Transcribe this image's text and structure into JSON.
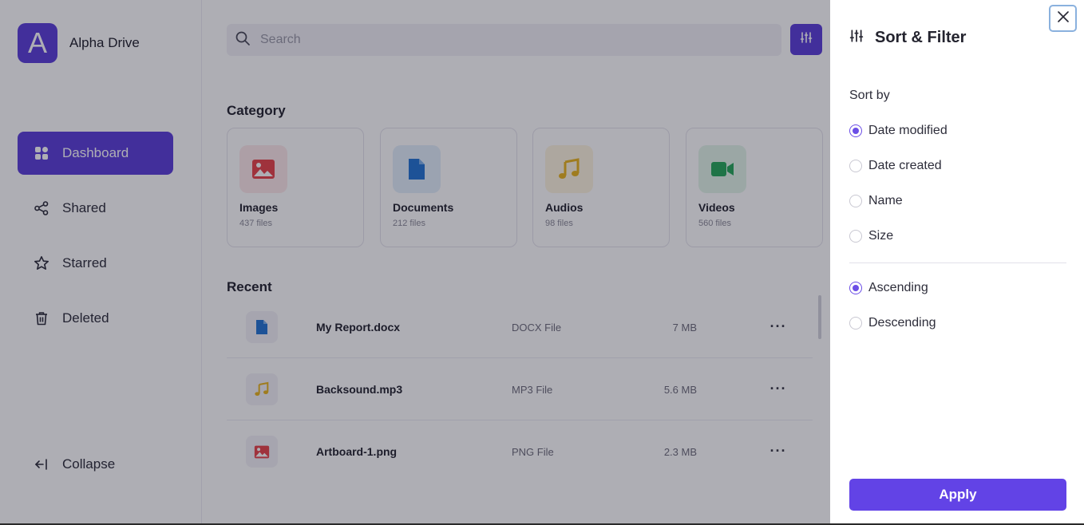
{
  "brand": {
    "logo_letter": "A",
    "name": "Alpha Drive"
  },
  "sidebar": {
    "items": [
      {
        "label": "Dashboard",
        "icon": "dashboard-grid-icon",
        "active": true
      },
      {
        "label": "Shared",
        "icon": "share-icon",
        "active": false
      },
      {
        "label": "Starred",
        "icon": "star-icon",
        "active": false
      },
      {
        "label": "Deleted",
        "icon": "trash-icon",
        "active": false
      }
    ],
    "collapse_label": "Collapse"
  },
  "search": {
    "placeholder": "Search",
    "value": ""
  },
  "category": {
    "title": "Category",
    "items": [
      {
        "name": "Images",
        "count": "437 files",
        "icon": "image-icon",
        "color": "#e8434a",
        "bg": "#fde9ea"
      },
      {
        "name": "Documents",
        "count": "212 files",
        "icon": "document-icon",
        "color": "#2474d4",
        "bg": "#e3eefb"
      },
      {
        "name": "Audios",
        "count": "98 files",
        "icon": "music-note-icon",
        "color": "#e8b41e",
        "bg": "#fdf5e0"
      },
      {
        "name": "Videos",
        "count": "560 files",
        "icon": "video-camera-icon",
        "color": "#27a85a",
        "bg": "#e2f5e9"
      }
    ]
  },
  "recent": {
    "title": "Recent",
    "files": [
      {
        "name": "My Report.docx",
        "type": "DOCX File",
        "size": "7 MB",
        "icon": "document-icon",
        "more": "···"
      },
      {
        "name": "Backsound.mp3",
        "type": "MP3 File",
        "size": "5.6 MB",
        "icon": "music-note-icon",
        "more": "···"
      },
      {
        "name": "Artboard-1.png",
        "type": "PNG File",
        "size": "2.3 MB",
        "icon": "image-icon",
        "more": "···"
      }
    ]
  },
  "panel": {
    "title": "Sort & Filter",
    "sort_by_label": "Sort by",
    "sort_options": [
      {
        "label": "Date modified",
        "selected": true
      },
      {
        "label": "Date created",
        "selected": false
      },
      {
        "label": "Name",
        "selected": false
      },
      {
        "label": "Size",
        "selected": false
      }
    ],
    "order_options": [
      {
        "label": "Ascending",
        "selected": true
      },
      {
        "label": "Descending",
        "selected": false
      }
    ],
    "apply_label": "Apply"
  },
  "colors": {
    "accent": "#5b3fd9",
    "apply": "#6243e6",
    "radio": "#6b4ee6"
  }
}
